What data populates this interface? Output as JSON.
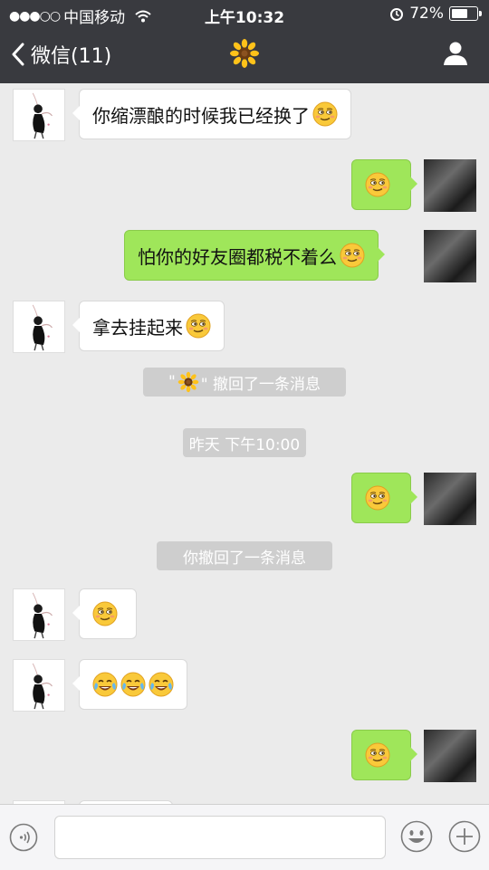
{
  "status": {
    "signal": "●●●○○",
    "carrier": "中国移动",
    "time": "上午10:32",
    "battery": "72%",
    "battery_level": 0.72
  },
  "nav": {
    "back_label": "微信(11)",
    "title_icon": "sunflower-icon",
    "profile_icon": "person-icon"
  },
  "chat": {
    "m1": "你缩漂酿的时候我已经换了",
    "m3": "怕你的好友圈都税不着么",
    "m4": "拿去挂起来",
    "recall1_prefix": "\"",
    "recall1_suffix": "\" 撤回了一条消息",
    "timestamp": "昨天  下午10:00",
    "recall2": "你撤回了一条消息"
  },
  "input": {
    "placeholder": "",
    "voice_icon": "voice-icon",
    "emoji_icon": "emoji-icon",
    "plus_icon": "plus-icon"
  },
  "colors": {
    "header_bg": "#393a3f",
    "chat_bg": "#ebebeb",
    "my_bubble": "#9fe65a",
    "their_bubble": "#ffffff",
    "system_pill": "#cecece"
  }
}
